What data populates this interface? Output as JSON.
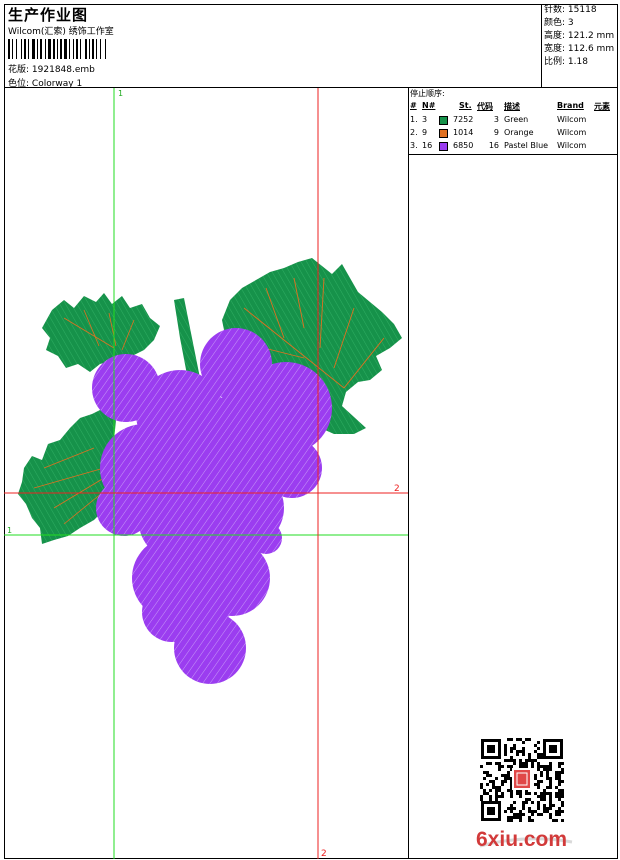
{
  "header": {
    "title": "生产作业图",
    "company": "Wilcom(汇索) 绣饰工作室",
    "design_label": "花版:",
    "design_value": "1921848.emb",
    "colorway_label": "色位:",
    "colorway_value": "Colorway 1"
  },
  "specs": [
    {
      "label": "针数:",
      "value": "15118"
    },
    {
      "label": "颜色:",
      "value": "3"
    },
    {
      "label": "高度:",
      "value": "121.2 mm"
    },
    {
      "label": "宽度:",
      "value": "112.6 mm"
    },
    {
      "label": "比例:",
      "value": "1.18"
    }
  ],
  "stop_sequence": {
    "heading": "停止顺序:",
    "columns": [
      "#",
      "N#",
      "St.",
      "代码",
      "描述",
      "Brand",
      "元素"
    ],
    "rows": [
      {
        "num": "1.",
        "needle": "3",
        "code": "7252",
        "stitches": "3",
        "desc": "Green",
        "brand": "Wilcom",
        "color": "#16924a"
      },
      {
        "num": "2.",
        "needle": "9",
        "code": "1014",
        "stitches": "9",
        "desc": "Orange",
        "brand": "Wilcom",
        "color": "#e07020"
      },
      {
        "num": "3.",
        "needle": "16",
        "code": "6850",
        "stitches": "16",
        "desc": "Pastel Blue",
        "brand": "Wilcom",
        "color": "#9b3df0"
      }
    ]
  },
  "guides": {
    "green_label_top": "1",
    "green_label_left": "1",
    "red_label_right": "2",
    "red_label_bottom": "2"
  },
  "design_colors": {
    "leaf": "#16924a",
    "vein": "#e07020",
    "grape": "#9b3df0",
    "grape_light": "#b57af5"
  },
  "watermark": {
    "logo": "6xiu.com"
  }
}
